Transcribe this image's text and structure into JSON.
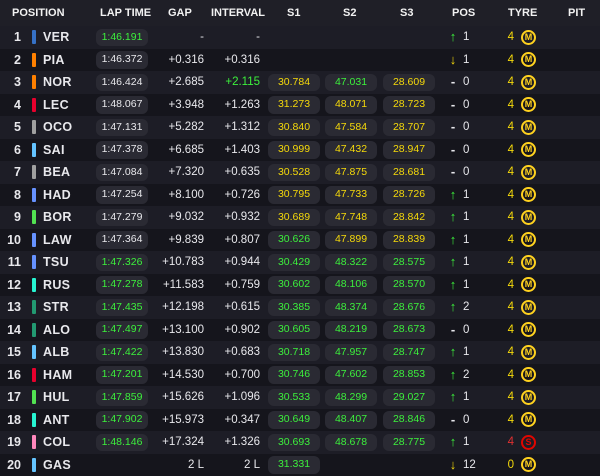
{
  "headers": {
    "position": "POSITION",
    "lap_time": "LAP TIME",
    "gap": "GAP",
    "interval": "INTERVAL",
    "s1": "S1",
    "s2": "S2",
    "s3": "S3",
    "pos": "POS",
    "tyre": "TYRE",
    "pit": "PIT"
  },
  "colors": {
    "green": "#3cf03c",
    "yellow": "#f5d90a",
    "white": "#e8e8ec",
    "grey": "#6e6e76",
    "red": "#e03030",
    "orange": "#ff9a1f",
    "medium": "#ffd21f",
    "soft": "#e10600"
  },
  "drivers": [
    {
      "pos": "1",
      "code": "VER",
      "team": "#3671c6",
      "lap": "1:46.191",
      "lap_c": "green",
      "gap": "-",
      "gap_c": "white",
      "intv": "-",
      "intv_c": "white",
      "s1": "",
      "s1_c": "grey",
      "s2": "",
      "s2_c": "grey",
      "s3": "",
      "s3_c": "grey",
      "arrow": "up",
      "change": "1",
      "tyre_age": "4",
      "tyre": "M"
    },
    {
      "pos": "2",
      "code": "PIA",
      "team": "#ff8000",
      "lap": "1:46.372",
      "lap_c": "white",
      "gap": "+0.316",
      "gap_c": "white",
      "intv": "+0.316",
      "intv_c": "white",
      "s1": "",
      "s1_c": "grey",
      "s2": "",
      "s2_c": "grey",
      "s3": "",
      "s3_c": "grey",
      "arrow": "down",
      "change": "1",
      "tyre_age": "4",
      "tyre": "M"
    },
    {
      "pos": "3",
      "code": "NOR",
      "team": "#ff8000",
      "lap": "1:46.424",
      "lap_c": "white",
      "gap": "+2.685",
      "gap_c": "white",
      "intv": "+2.115",
      "intv_c": "green",
      "s1": "30.784",
      "s1_c": "yellow",
      "s2": "47.031",
      "s2_c": "green",
      "s3": "28.609",
      "s3_c": "yellow",
      "arrow": "dash",
      "change": "0",
      "tyre_age": "4",
      "tyre": "M"
    },
    {
      "pos": "4",
      "code": "LEC",
      "team": "#e8002d",
      "lap": "1:48.067",
      "lap_c": "white",
      "gap": "+3.948",
      "gap_c": "white",
      "intv": "+1.263",
      "intv_c": "white",
      "s1": "31.273",
      "s1_c": "yellow",
      "s2": "48.071",
      "s2_c": "yellow",
      "s3": "28.723",
      "s3_c": "yellow",
      "arrow": "dash",
      "change": "0",
      "tyre_age": "4",
      "tyre": "M"
    },
    {
      "pos": "5",
      "code": "OCO",
      "team": "#a0a0a0",
      "lap": "1:47.131",
      "lap_c": "white",
      "gap": "+5.282",
      "gap_c": "white",
      "intv": "+1.312",
      "intv_c": "white",
      "s1": "30.840",
      "s1_c": "yellow",
      "s2": "47.584",
      "s2_c": "yellow",
      "s3": "28.707",
      "s3_c": "yellow",
      "arrow": "dash",
      "change": "0",
      "tyre_age": "4",
      "tyre": "M"
    },
    {
      "pos": "6",
      "code": "SAI",
      "team": "#64c4ff",
      "lap": "1:47.378",
      "lap_c": "white",
      "gap": "+6.685",
      "gap_c": "white",
      "intv": "+1.403",
      "intv_c": "white",
      "s1": "30.999",
      "s1_c": "yellow",
      "s2": "47.432",
      "s2_c": "yellow",
      "s3": "28.947",
      "s3_c": "yellow",
      "arrow": "dash",
      "change": "0",
      "tyre_age": "4",
      "tyre": "M"
    },
    {
      "pos": "7",
      "code": "BEA",
      "team": "#a0a0a0",
      "lap": "1:47.084",
      "lap_c": "white",
      "gap": "+7.320",
      "gap_c": "white",
      "intv": "+0.635",
      "intv_c": "white",
      "s1": "30.528",
      "s1_c": "yellow",
      "s2": "47.875",
      "s2_c": "yellow",
      "s3": "28.681",
      "s3_c": "yellow",
      "arrow": "dash",
      "change": "0",
      "tyre_age": "4",
      "tyre": "M"
    },
    {
      "pos": "8",
      "code": "HAD",
      "team": "#6692ff",
      "lap": "1:47.254",
      "lap_c": "white",
      "gap": "+8.100",
      "gap_c": "white",
      "intv": "+0.726",
      "intv_c": "white",
      "s1": "30.795",
      "s1_c": "yellow",
      "s2": "47.733",
      "s2_c": "yellow",
      "s3": "28.726",
      "s3_c": "yellow",
      "arrow": "up",
      "change": "1",
      "tyre_age": "4",
      "tyre": "M"
    },
    {
      "pos": "9",
      "code": "BOR",
      "team": "#52e252",
      "lap": "1:47.279",
      "lap_c": "white",
      "gap": "+9.032",
      "gap_c": "white",
      "intv": "+0.932",
      "intv_c": "white",
      "s1": "30.689",
      "s1_c": "yellow",
      "s2": "47.748",
      "s2_c": "yellow",
      "s3": "28.842",
      "s3_c": "yellow",
      "arrow": "up",
      "change": "1",
      "tyre_age": "4",
      "tyre": "M"
    },
    {
      "pos": "10",
      "code": "LAW",
      "team": "#6692ff",
      "lap": "1:47.364",
      "lap_c": "white",
      "gap": "+9.839",
      "gap_c": "white",
      "intv": "+0.807",
      "intv_c": "white",
      "s1": "30.626",
      "s1_c": "green",
      "s2": "47.899",
      "s2_c": "yellow",
      "s3": "28.839",
      "s3_c": "yellow",
      "arrow": "up",
      "change": "1",
      "tyre_age": "4",
      "tyre": "M"
    },
    {
      "pos": "11",
      "code": "TSU",
      "team": "#6692ff",
      "lap": "1:47.326",
      "lap_c": "green",
      "gap": "+10.783",
      "gap_c": "white",
      "intv": "+0.944",
      "intv_c": "white",
      "s1": "30.429",
      "s1_c": "green",
      "s2": "48.322",
      "s2_c": "green",
      "s3": "28.575",
      "s3_c": "green",
      "arrow": "up",
      "change": "1",
      "tyre_age": "4",
      "tyre": "M"
    },
    {
      "pos": "12",
      "code": "RUS",
      "team": "#27f4d2",
      "lap": "1:47.278",
      "lap_c": "green",
      "gap": "+11.583",
      "gap_c": "white",
      "intv": "+0.759",
      "intv_c": "white",
      "s1": "30.602",
      "s1_c": "green",
      "s2": "48.106",
      "s2_c": "green",
      "s3": "28.570",
      "s3_c": "green",
      "arrow": "up",
      "change": "1",
      "tyre_age": "4",
      "tyre": "M"
    },
    {
      "pos": "13",
      "code": "STR",
      "team": "#229971",
      "lap": "1:47.435",
      "lap_c": "green",
      "gap": "+12.198",
      "gap_c": "white",
      "intv": "+0.615",
      "intv_c": "white",
      "s1": "30.385",
      "s1_c": "green",
      "s2": "48.374",
      "s2_c": "green",
      "s3": "28.676",
      "s3_c": "green",
      "arrow": "up",
      "change": "2",
      "tyre_age": "4",
      "tyre": "M"
    },
    {
      "pos": "14",
      "code": "ALO",
      "team": "#229971",
      "lap": "1:47.497",
      "lap_c": "green",
      "gap": "+13.100",
      "gap_c": "white",
      "intv": "+0.902",
      "intv_c": "white",
      "s1": "30.605",
      "s1_c": "green",
      "s2": "48.219",
      "s2_c": "green",
      "s3": "28.673",
      "s3_c": "green",
      "arrow": "dash",
      "change": "0",
      "tyre_age": "4",
      "tyre": "M"
    },
    {
      "pos": "15",
      "code": "ALB",
      "team": "#64c4ff",
      "lap": "1:47.422",
      "lap_c": "green",
      "gap": "+13.830",
      "gap_c": "white",
      "intv": "+0.683",
      "intv_c": "white",
      "s1": "30.718",
      "s1_c": "green",
      "s2": "47.957",
      "s2_c": "green",
      "s3": "28.747",
      "s3_c": "green",
      "arrow": "up",
      "change": "1",
      "tyre_age": "4",
      "tyre": "M"
    },
    {
      "pos": "16",
      "code": "HAM",
      "team": "#e8002d",
      "lap": "1:47.201",
      "lap_c": "green",
      "gap": "+14.530",
      "gap_c": "white",
      "intv": "+0.700",
      "intv_c": "white",
      "s1": "30.746",
      "s1_c": "green",
      "s2": "47.602",
      "s2_c": "green",
      "s3": "28.853",
      "s3_c": "green",
      "arrow": "up",
      "change": "2",
      "tyre_age": "4",
      "tyre": "M"
    },
    {
      "pos": "17",
      "code": "HUL",
      "team": "#52e252",
      "lap": "1:47.859",
      "lap_c": "green",
      "gap": "+15.626",
      "gap_c": "white",
      "intv": "+1.096",
      "intv_c": "white",
      "s1": "30.533",
      "s1_c": "green",
      "s2": "48.299",
      "s2_c": "green",
      "s3": "29.027",
      "s3_c": "green",
      "arrow": "up",
      "change": "1",
      "tyre_age": "4",
      "tyre": "M"
    },
    {
      "pos": "18",
      "code": "ANT",
      "team": "#27f4d2",
      "lap": "1:47.902",
      "lap_c": "green",
      "gap": "+15.973",
      "gap_c": "white",
      "intv": "+0.347",
      "intv_c": "white",
      "s1": "30.649",
      "s1_c": "green",
      "s2": "48.407",
      "s2_c": "green",
      "s3": "28.846",
      "s3_c": "green",
      "arrow": "dash",
      "change": "0",
      "tyre_age": "4",
      "tyre": "M"
    },
    {
      "pos": "19",
      "code": "COL",
      "team": "#ff87bc",
      "lap": "1:48.146",
      "lap_c": "green",
      "gap": "+17.324",
      "gap_c": "white",
      "intv": "+1.326",
      "intv_c": "white",
      "s1": "30.693",
      "s1_c": "green",
      "s2": "48.678",
      "s2_c": "green",
      "s3": "28.775",
      "s3_c": "green",
      "arrow": "up",
      "change": "1",
      "tyre_age": "4",
      "tyre": "S"
    },
    {
      "pos": "20",
      "code": "GAS",
      "team": "#64c4ff",
      "lap": "",
      "lap_c": "white",
      "gap": "2 L",
      "gap_c": "white",
      "intv": "2 L",
      "intv_c": "white",
      "s1": "31.331",
      "s1_c": "green",
      "s2": "",
      "s2_c": "grey",
      "s3": "",
      "s3_c": "grey",
      "arrow": "down",
      "change": "12",
      "tyre_age": "0",
      "tyre": "M"
    }
  ]
}
